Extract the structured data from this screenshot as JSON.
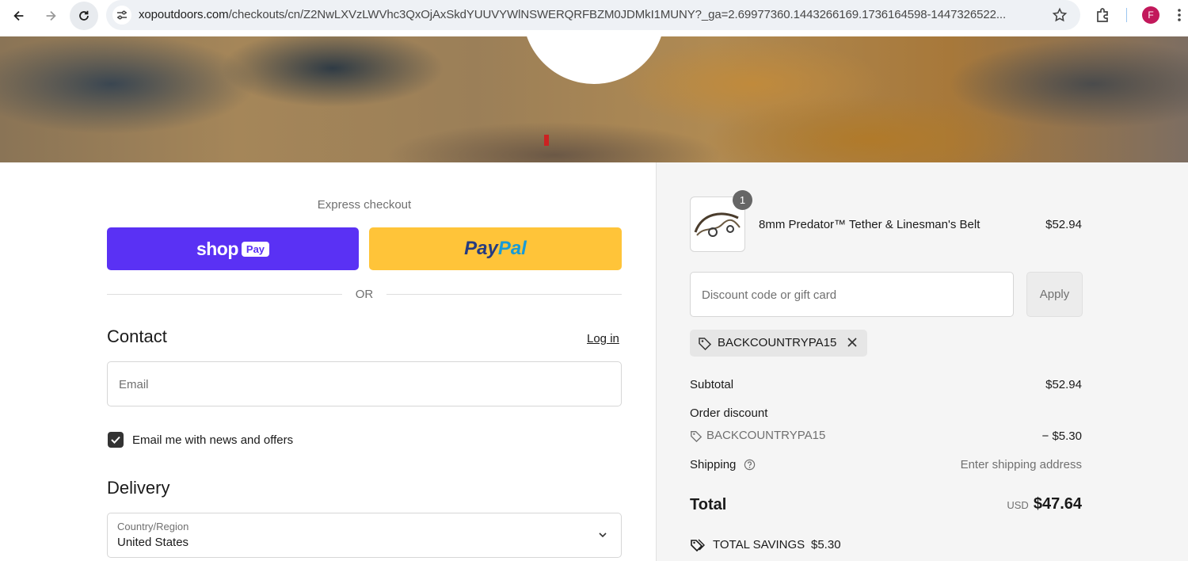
{
  "browser": {
    "url_host": "xopoutdoors.com",
    "url_path": "/checkouts/cn/Z2NwLXVzLWVhc3QxOjAxSkdYUUVYWlNSWERQRFBZM0JDMkI1MUNY?_ga=2.69977360.1443266169.1736164598-1447326522...",
    "profile_initial": "F"
  },
  "express": {
    "title": "Express checkout",
    "shop_label": "shop",
    "shop_pay_badge": "Pay",
    "paypal_pay": "Pay",
    "paypal_pal": "Pal",
    "or_label": "OR"
  },
  "contact": {
    "heading": "Contact",
    "login_link": "Log in",
    "email_placeholder": "Email",
    "news_label": "Email me with news and offers",
    "news_checked": true
  },
  "delivery": {
    "heading": "Delivery",
    "country_label": "Country/Region",
    "country_value": "United States"
  },
  "summary": {
    "item": {
      "quantity": "1",
      "name": "8mm Predator™ Tether & Linesman's Belt",
      "price": "$52.94"
    },
    "discount_placeholder": "Discount code or gift card",
    "apply_label": "Apply",
    "applied_code": "BACKCOUNTRYPA15",
    "subtotal_label": "Subtotal",
    "subtotal_value": "$52.94",
    "order_discount_label": "Order discount",
    "discount_code": "BACKCOUNTRYPA15",
    "discount_value": "− $5.30",
    "shipping_label": "Shipping",
    "shipping_value": "Enter shipping address",
    "total_label": "Total",
    "currency": "USD",
    "total_value": "$47.64",
    "savings_label": "TOTAL SAVINGS",
    "savings_value": "$5.30"
  },
  "colors": {
    "shop_pay": "#5a31f4",
    "paypal": "#ffc439",
    "summary_bg": "#f5f5f5"
  }
}
